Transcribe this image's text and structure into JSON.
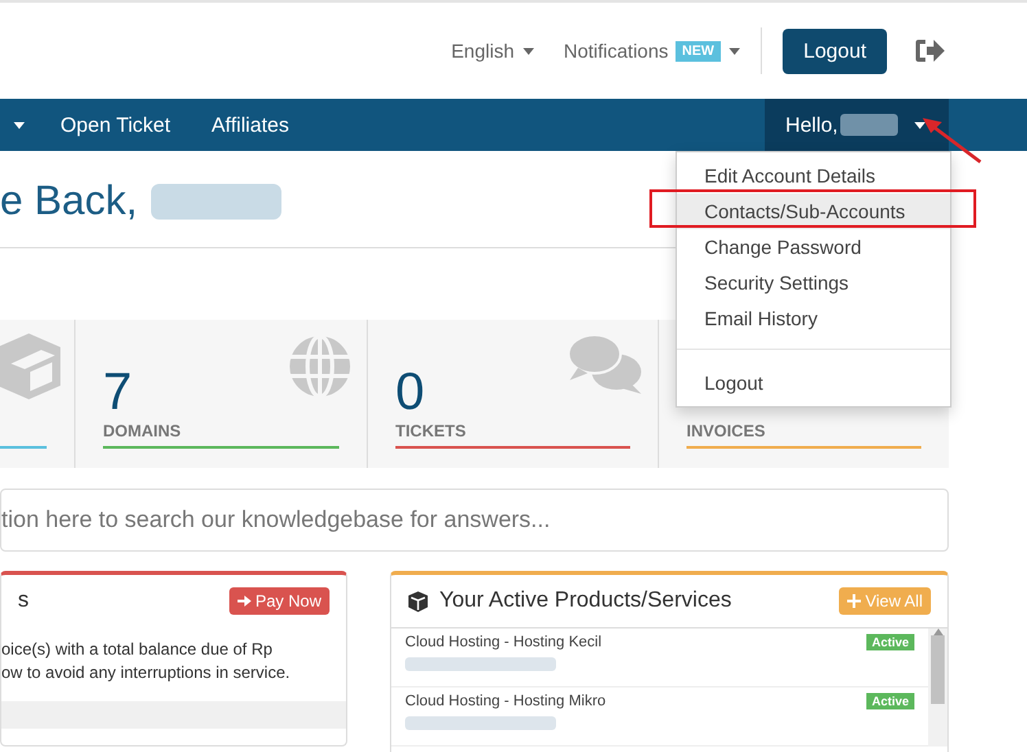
{
  "header": {
    "language": "English",
    "notifications": {
      "label": "Notifications",
      "badge": "NEW"
    },
    "logout_button": "Logout"
  },
  "navbar": {
    "items": [
      {
        "label": "Open Ticket"
      },
      {
        "label": "Affiliates"
      }
    ],
    "user_menu": {
      "label": "Hello,",
      "expanded": true,
      "items": [
        {
          "kind": "item",
          "label": "Edit Account Details",
          "selected": false
        },
        {
          "kind": "item",
          "label": "Contacts/Sub-Accounts",
          "selected": true
        },
        {
          "kind": "item",
          "label": "Change Password",
          "selected": false
        },
        {
          "kind": "item",
          "label": "Security Settings",
          "selected": false
        },
        {
          "kind": "item",
          "label": "Email History",
          "selected": false
        },
        {
          "kind": "divider"
        },
        {
          "kind": "item",
          "label": "Logout",
          "selected": false
        }
      ]
    }
  },
  "welcome": "e Back,",
  "stats": [
    {
      "kind": "box",
      "color": "#5bc0de"
    },
    {
      "kind": "globe",
      "value": "7",
      "label": "DOMAINS",
      "color": "#5cb85c"
    },
    {
      "kind": "chat",
      "value": "0",
      "label": "TICKETS",
      "color": "#d9534f"
    },
    {
      "kind": "doc",
      "label": "INVOICES",
      "color": "#f0ad4e"
    }
  ],
  "search": {
    "placeholder": "tion here to search our knowledgebase for answers..."
  },
  "invoices_panel": {
    "title": "s",
    "button": "Pay Now",
    "lines": [
      "oice(s) with a total balance due of Rp",
      "ow to avoid any interruptions in service."
    ]
  },
  "products_panel": {
    "title": "Your Active Products/Services",
    "button": "View All",
    "rows": [
      {
        "name": "Cloud Hosting - Hosting Kecil",
        "status": "Active"
      },
      {
        "name": "Cloud Hosting - Hosting Mikro",
        "status": "Active"
      }
    ]
  }
}
